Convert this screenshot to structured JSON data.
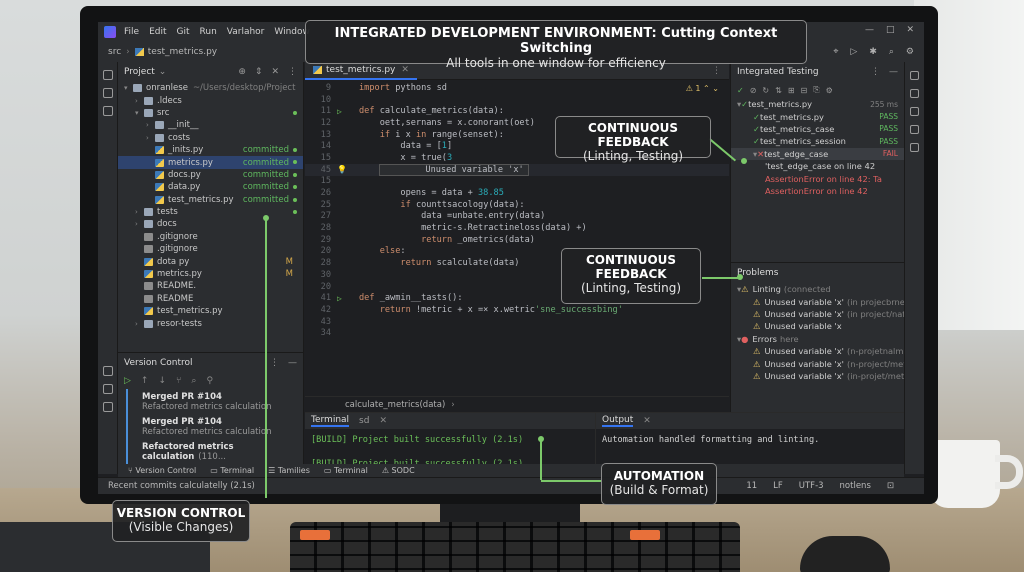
{
  "menu": [
    "File",
    "Edit",
    "Git",
    "Run",
    "Varlahor",
    "Window"
  ],
  "breadcrumb": {
    "folder": "src",
    "file": "test_metrics.py"
  },
  "project_panel": {
    "title": "Project",
    "tree": [
      {
        "label": "onranlese",
        "path": "~/Users/desktop/Project",
        "depth": 0,
        "type": "folder",
        "arrow": "▾"
      },
      {
        "label": ".ldecs",
        "depth": 1,
        "type": "folder",
        "arrow": "›"
      },
      {
        "label": "src",
        "depth": 1,
        "type": "folder",
        "arrow": "▾",
        "dot": true
      },
      {
        "label": "__init__",
        "depth": 2,
        "type": "folder",
        "arrow": "›"
      },
      {
        "label": "costs",
        "depth": 2,
        "type": "folder",
        "arrow": "›"
      },
      {
        "label": "_inits.py",
        "depth": 2,
        "type": "py",
        "status": "committed",
        "dot": true
      },
      {
        "label": "metrics.py",
        "depth": 2,
        "type": "py",
        "status": "committed",
        "dot": true,
        "selected": true
      },
      {
        "label": "docs.py",
        "depth": 2,
        "type": "py",
        "status": "committed",
        "dot": true
      },
      {
        "label": "data.py",
        "depth": 2,
        "type": "py",
        "status": "committed",
        "dot": true
      },
      {
        "label": "test_metrics.py",
        "depth": 2,
        "type": "py",
        "status": "committed",
        "dot": true
      },
      {
        "label": "tests",
        "depth": 1,
        "type": "folder",
        "arrow": "›",
        "dot": true
      },
      {
        "label": "docs",
        "depth": 1,
        "type": "folder",
        "arrow": "›"
      },
      {
        "label": ".gitignore",
        "depth": 1,
        "type": "txt"
      },
      {
        "label": ".gitignore",
        "depth": 1,
        "type": "txt"
      },
      {
        "label": "dota py",
        "depth": 1,
        "type": "py",
        "mod": "M"
      },
      {
        "label": "metrics.py",
        "depth": 1,
        "type": "py",
        "mod": "M"
      },
      {
        "label": "README.",
        "depth": 1,
        "type": "txt"
      },
      {
        "label": "README",
        "depth": 1,
        "type": "txt"
      },
      {
        "label": "test_metrics.py",
        "depth": 1,
        "type": "py"
      },
      {
        "label": "resor-tests",
        "depth": 1,
        "type": "folder",
        "arrow": "›"
      }
    ]
  },
  "version_control": {
    "title": "Version Control",
    "commits": [
      {
        "title": "Merged PR #104",
        "subtitle": "Refactored metrics calculation"
      },
      {
        "title": "Merged PR #104",
        "subtitle": "Refactored metrics calculation"
      },
      {
        "title": "Refactored metrics calculation",
        "subtitle": "(110..."
      }
    ]
  },
  "editor": {
    "tab": "test_metrics.py",
    "warning_count": "1",
    "footer": "calculate_metrics(data)",
    "lines": [
      {
        "n": "9",
        "code": "import pythons sd"
      },
      {
        "n": "10",
        "code": ""
      },
      {
        "n": "11",
        "code": "def calculate_metrics(data):",
        "gut": "▷"
      },
      {
        "n": "12",
        "code": "    oett,sernans = x.conorant(oet)"
      },
      {
        "n": "13",
        "code": "    if i x in range(senset):"
      },
      {
        "n": "14",
        "code": "        data = [1]"
      },
      {
        "n": "15",
        "code": "        x = true(3"
      },
      {
        "n": "45",
        "code": "        Unused variable 'x'",
        "hint": true,
        "gut": "💡"
      },
      {
        "n": "15",
        "code": ""
      },
      {
        "n": "26",
        "code": "        opens = data + 38.85"
      },
      {
        "n": "25",
        "code": "        if counttsacology(data):"
      },
      {
        "n": "27",
        "code": "            data =unbate.entry(data)"
      },
      {
        "n": "28",
        "code": "            metric-s.Retractineloss(data) +)"
      },
      {
        "n": "29",
        "code": "            return _ometrics(data)"
      },
      {
        "n": "20",
        "code": "    else:"
      },
      {
        "n": "28",
        "code": "        return scalculate(data)"
      },
      {
        "n": "30",
        "code": ""
      },
      {
        "n": "20",
        "code": ""
      },
      {
        "n": "41",
        "code": "def _awmin__tasts():",
        "gut": "▷"
      },
      {
        "n": "42",
        "code": "    return !metric + x =× x.wetric'sne_successbing'"
      },
      {
        "n": "43",
        "code": ""
      },
      {
        "n": "34",
        "code": ""
      }
    ]
  },
  "testing": {
    "title": "Integrated Testing",
    "rows": [
      {
        "label": "test_metrics.py",
        "res": "255 ms",
        "kind": "root"
      },
      {
        "label": "test_metrics.py",
        "res": "PASS",
        "kind": "pass"
      },
      {
        "label": "test_metrics_case",
        "res": "PASS",
        "kind": "pass"
      },
      {
        "label": "test_metrics_session",
        "res": "PASS",
        "kind": "pass"
      },
      {
        "label": "test_edge_case",
        "res": "FAIL",
        "kind": "fail"
      },
      {
        "label": "'test_edge_case on line 42",
        "res": "",
        "kind": "plain"
      },
      {
        "label": "AssertionError on line 42: Ta",
        "res": "",
        "kind": "err"
      },
      {
        "label": "AssertionError on line 42",
        "res": "",
        "kind": "err"
      }
    ]
  },
  "problems": {
    "title": "Problems",
    "rows": [
      {
        "icon": "warn",
        "label": "Linting",
        "dim": "(connected",
        "depth": 0
      },
      {
        "icon": "warn",
        "label": "Unused variable 'x'",
        "dim": "(in projecbrnetmin",
        "depth": 1
      },
      {
        "icon": "warn",
        "label": "Unused variable 'x'",
        "dim": "(in project/nafmi",
        "depth": 1
      },
      {
        "icon": "warn",
        "label": "Unused variable 'x",
        "dim": "",
        "depth": 1
      },
      {
        "icon": "err",
        "label": "Errors",
        "dim": "here",
        "depth": 0
      },
      {
        "icon": "warn",
        "label": "Unused variable 'x'",
        "dim": "(n-projetnalmin",
        "depth": 1
      },
      {
        "icon": "warn",
        "label": "Unused variable 'x'",
        "dim": "(n-project/metmin",
        "depth": 1
      },
      {
        "icon": "warn",
        "label": "Unused variable 'x'",
        "dim": "(in-projet/metmin",
        "depth": 1
      }
    ]
  },
  "terminal": {
    "tab": "Terminal",
    "tab2": "sd",
    "lines": [
      "[BUILD] Project built successfully (2.1s)",
      "[BUILD] Project built successfully (2.1s)"
    ]
  },
  "output": {
    "tab": "Output",
    "line": "Automation handled formatting and linting."
  },
  "bottom_tabs": [
    "Version Control",
    "Terminal",
    "Tamilies",
    "Terminal",
    "SODC"
  ],
  "status": {
    "left": "Recent commits calculatelly (2.1s)",
    "line": "11",
    "eol": "LF",
    "enc": "UTF-3",
    "extra": "notlens"
  },
  "callouts": {
    "ide_title": "INTEGRATED DEVELOPMENT ENVIRONMENT: Cutting Context Switching",
    "ide_sub": "All tools in one window for efficiency",
    "cf1_title": "CONTINUOUS FEEDBACK",
    "cf1_sub": "(Linting, Testing)",
    "cf2_title": "CONTINUOUS FEEDBACK",
    "cf2_sub": "(Linting, Testing)",
    "auto_title": "AUTOMATION",
    "auto_sub": "(Build & Format)",
    "vc_title": "VERSION CONTROL",
    "vc_sub": "(Visible Changes)"
  },
  "colors": {
    "accent": "#3574f0",
    "pass": "#5fb85f",
    "fail": "#e06060",
    "leader": "#7cc96a"
  }
}
